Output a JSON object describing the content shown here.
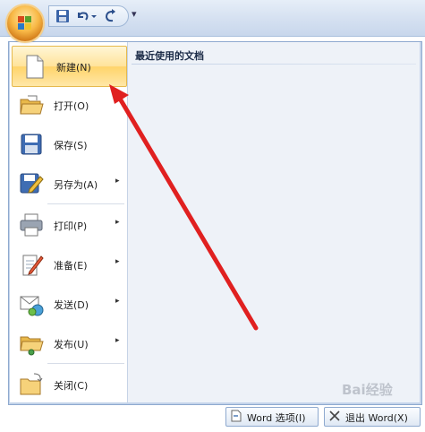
{
  "quick_access": {
    "more_glyph": "▾"
  },
  "menu": {
    "items": [
      {
        "label": "新建(N)"
      },
      {
        "label": "打开(O)"
      },
      {
        "label": "保存(S)"
      },
      {
        "label": "另存为(A)",
        "arrow": "▸"
      },
      {
        "label": "打印(P)",
        "arrow": "▸"
      },
      {
        "label": "准备(E)",
        "arrow": "▸"
      },
      {
        "label": "发送(D)",
        "arrow": "▸"
      },
      {
        "label": "发布(U)",
        "arrow": "▸"
      },
      {
        "label": "关闭(C)"
      }
    ]
  },
  "recent": {
    "title": "最近使用的文档"
  },
  "footer": {
    "options_label": "Word 选项(I)",
    "exit_label": "退出 Word(X)"
  },
  "watermark": {
    "text": "Bai经验"
  },
  "colors": {
    "annotation_arrow": "#e02020",
    "active_highlight": "#ffd46a"
  }
}
